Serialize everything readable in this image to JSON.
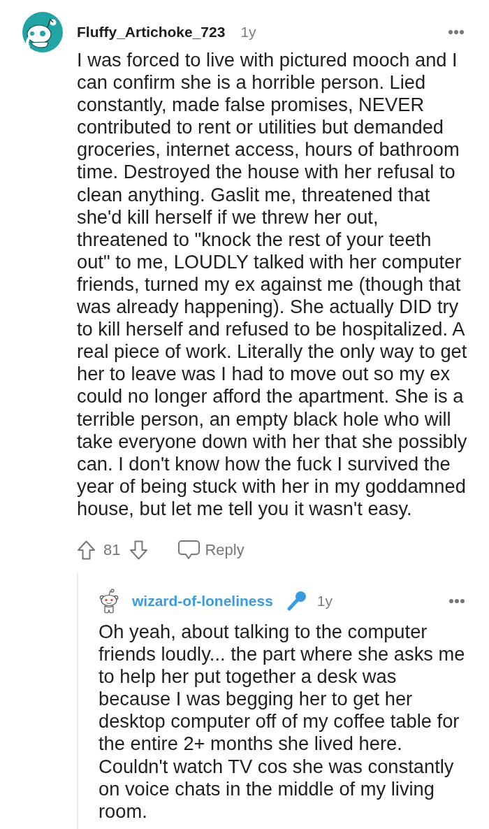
{
  "thread": [
    {
      "author": "Fluffy_Artichoke_723",
      "avatar": {
        "kind": "filled"
      },
      "name_highlighted": false,
      "flair_icon": false,
      "age": "1y",
      "body": "I was forced to live with pictured mooch and I can confirm she is a horrible person. Lied constantly, made false promises, NEVER contributed to rent or utilities but demanded groceries, internet access, hours of bathroom time. Destroyed the house with her refusal to clean anything. Gaslit me, threatened that she'd kill herself if we threw her out, threatened to \"knock the rest of your teeth out\" to me, LOUDLY talked with her computer friends, turned my ex against me (though that was already happening). She actually DID try to kill herself and refused to be hospitalized. A real piece of work. Literally the only way to get her to leave was I had to move out so my ex could no longer afford the apartment. She is a terrible person, an empty black hole who will take everyone down with her that she possibly can. I don't know how the fuck I survived the year of being stuck with her in my goddamned house, but let me tell you it wasn't easy.",
      "votes": "81",
      "reply_label": "Reply",
      "children": [
        {
          "author": "wizard-of-loneliness",
          "avatar": {
            "kind": "outline"
          },
          "name_highlighted": true,
          "flair_icon": true,
          "age": "1y",
          "body": "Oh yeah, about talking to the computer friends loudly... the part where she asks me to help her put together a desk was because I was begging her to get her desktop computer off of my coffee table for the entire 2+ months she lived here. Couldn't watch TV cos she was constantly on voice chats in the middle of my living room."
        }
      ]
    }
  ]
}
